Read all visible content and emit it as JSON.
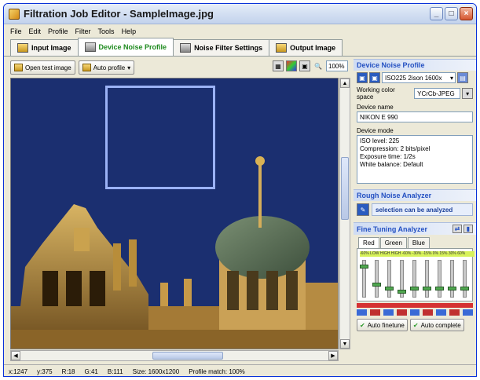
{
  "window": {
    "title": "Filtration Job Editor - SampleImage.jpg"
  },
  "menu": [
    "File",
    "Edit",
    "Profile",
    "Filter",
    "Tools",
    "Help"
  ],
  "tabs": [
    {
      "label": "Input Image",
      "active": false
    },
    {
      "label": "Device Noise Profile",
      "active": true
    },
    {
      "label": "Noise Filter Settings",
      "active": false
    },
    {
      "label": "Output Image",
      "active": false
    }
  ],
  "toolbar": {
    "open_test_image": "Open test image",
    "auto_profile": "Auto profile",
    "zoom": "100%"
  },
  "status": {
    "x": "x:1247",
    "y": "y:375",
    "r": "R:18",
    "g": "G:41",
    "b": "B:111",
    "size": "Size: 1600x1200",
    "profile_match": "Profile match: 100%"
  },
  "side": {
    "profile_header": "Device Noise Profile",
    "profile_value": "ISO225 2ison 1600x",
    "working_space_label": "Working color space",
    "working_space_value": "YCrCb-JPEG",
    "device_name_label": "Device name",
    "device_name_value": "NIKON E 990",
    "device_mode_label": "Device mode",
    "device_mode_lines": [
      "ISO level: 225",
      "Compression: 2 bits/pixel",
      "Exposure time: 1/2s",
      "White balance: Default"
    ],
    "rough_header": "Rough Noise Analyzer",
    "rough_msg": "selection can be analyzed",
    "fine_header": "Fine Tuning Analyzer",
    "fine_tabs": [
      "Red",
      "Green",
      "Blue"
    ],
    "strip_text": "-60% LOW HIGH HIGH -60% -30% -15% 0% 15% 30% 60%",
    "auto_finetune": "Auto finetune",
    "auto_complete": "Auto complete"
  },
  "sliders": [
    0.85,
    0.32,
    0.22,
    0.12,
    0.2,
    0.2,
    0.2,
    0.2,
    0.2
  ],
  "colors": {
    "accent": "#1d8a1d",
    "header": "#2350c2",
    "sky": "#1b2f70"
  }
}
